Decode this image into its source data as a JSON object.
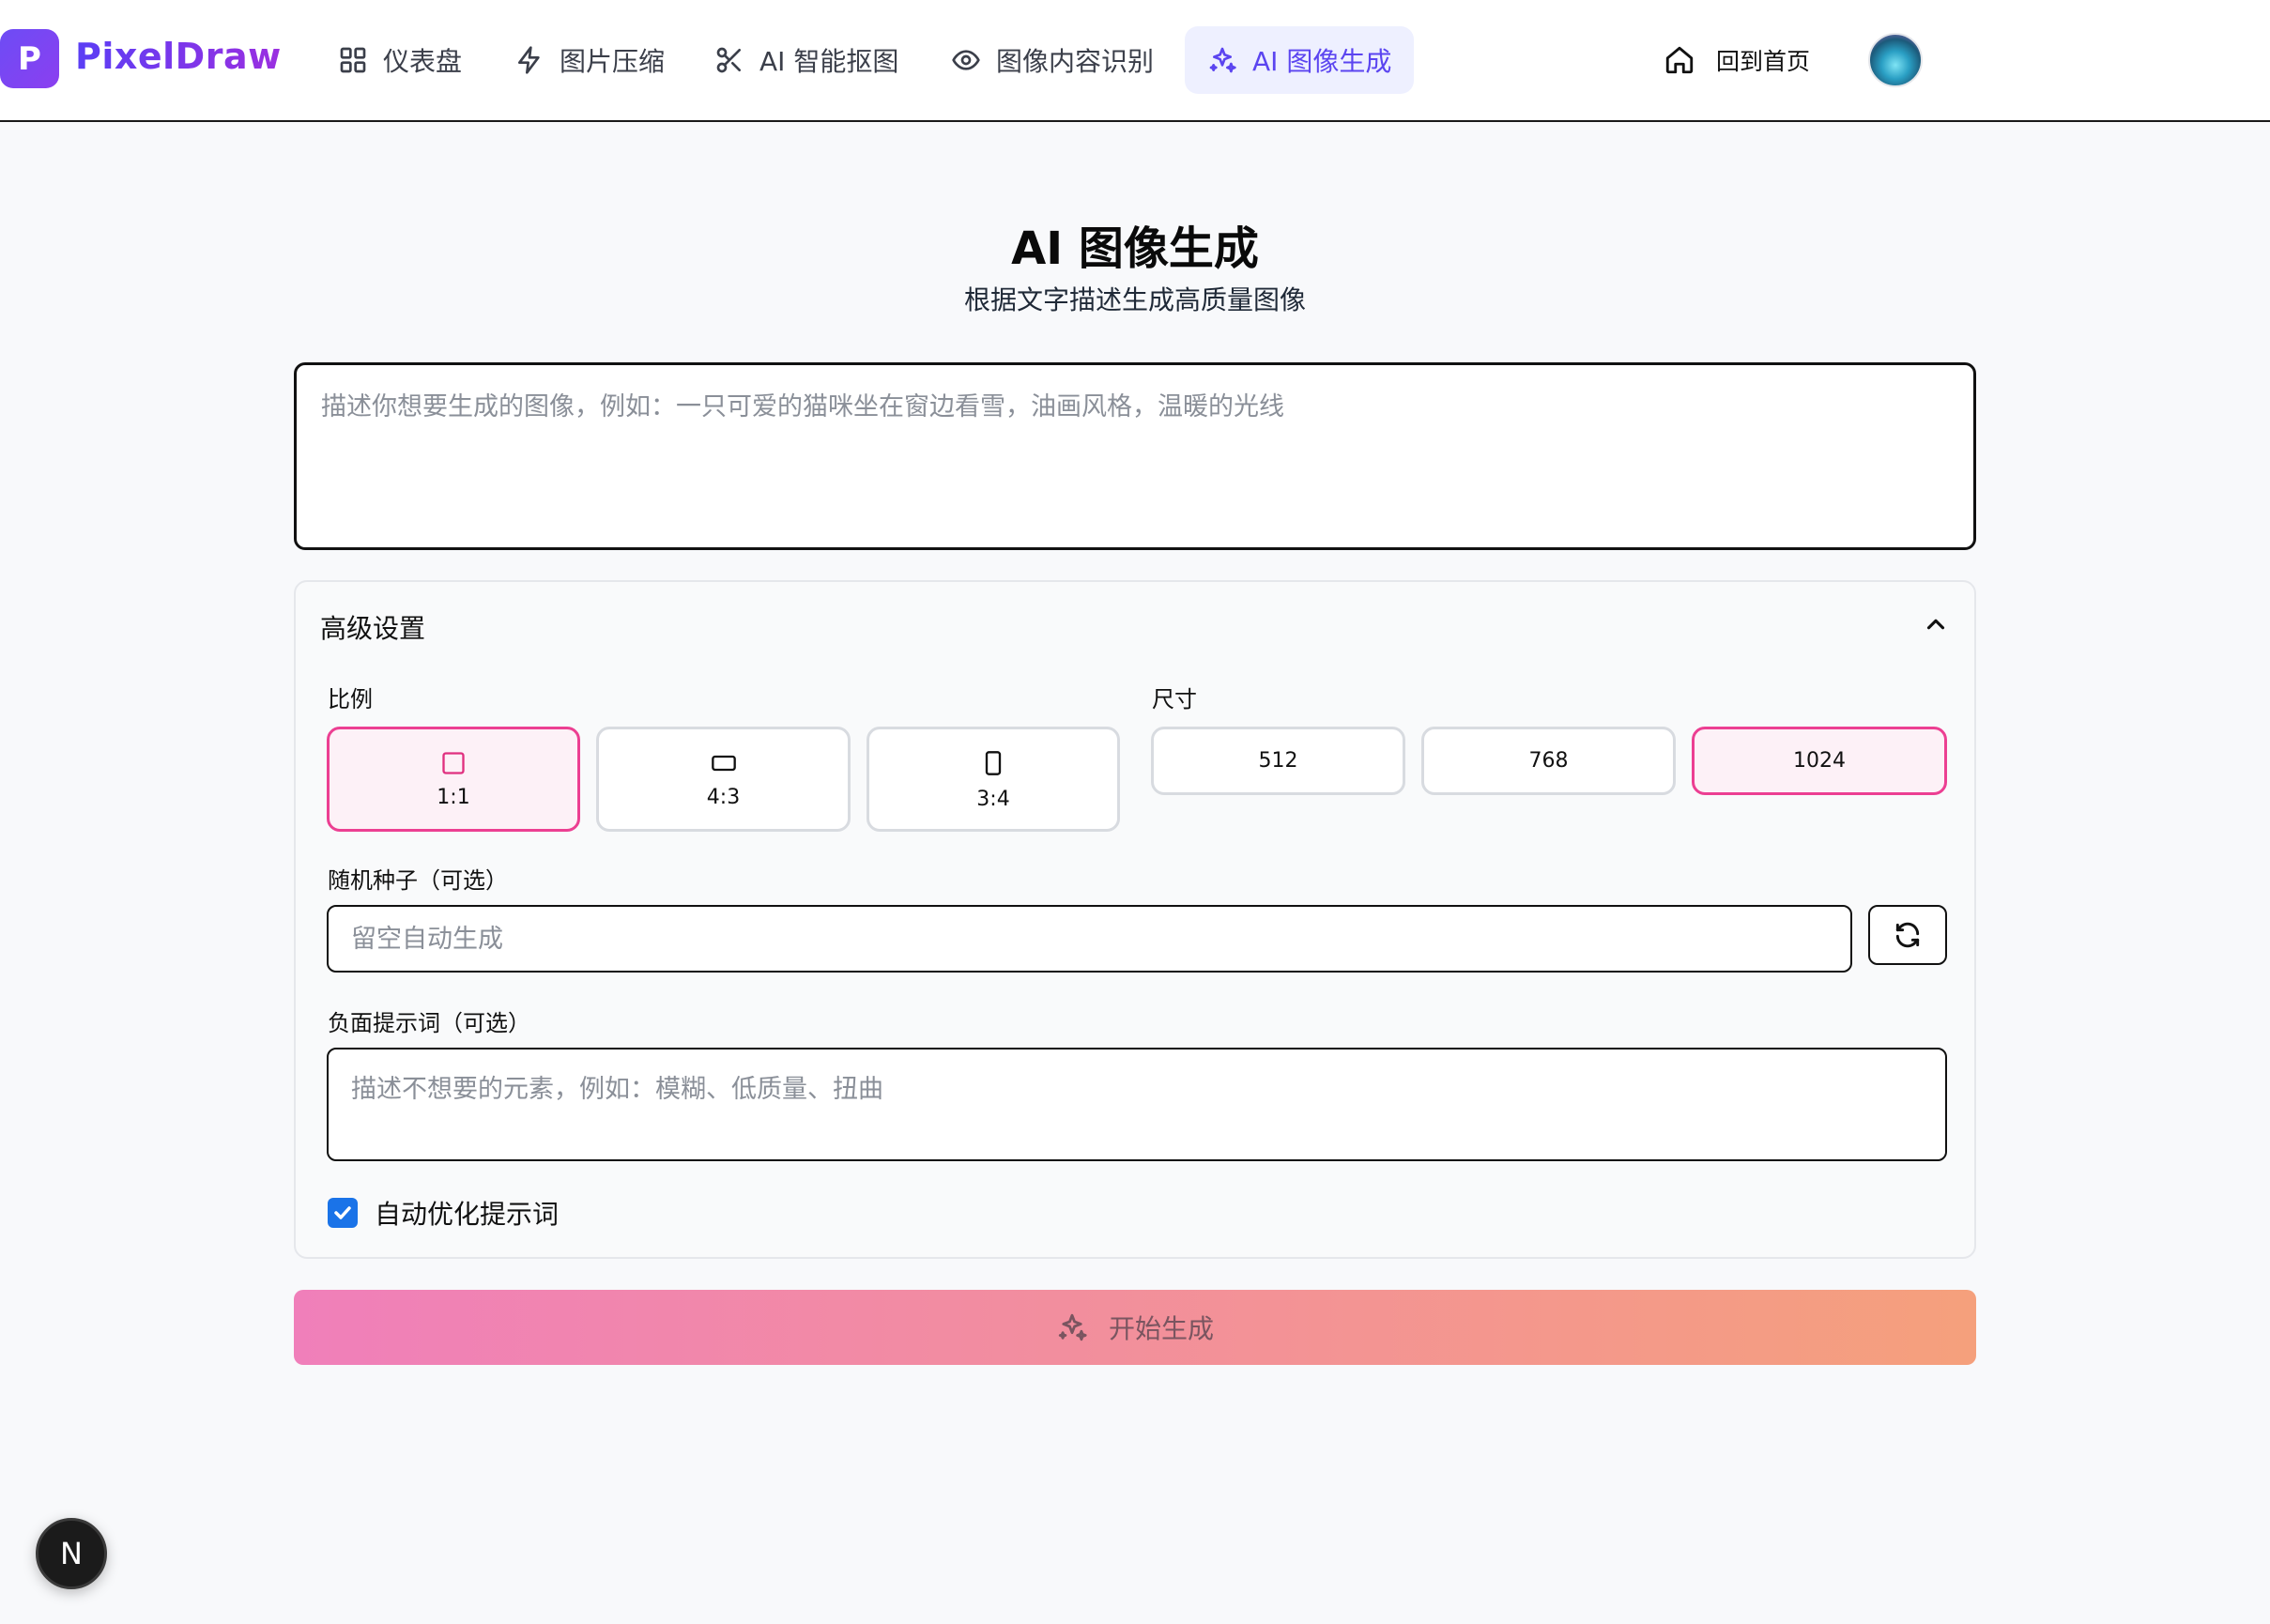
{
  "app": {
    "logo_letter": "P",
    "name": "PixelDraw"
  },
  "nav": {
    "items": [
      {
        "label": "仪表盘",
        "icon": "grid-icon"
      },
      {
        "label": "图片压缩",
        "icon": "lightning-icon"
      },
      {
        "label": "AI 智能抠图",
        "icon": "scissors-icon"
      },
      {
        "label": "图像内容识别",
        "icon": "eye-icon"
      },
      {
        "label": "AI 图像生成",
        "icon": "sparkles-icon",
        "active": true
      }
    ],
    "home_label": "回到首页"
  },
  "page": {
    "title": "AI 图像生成",
    "subtitle": "根据文字描述生成高质量图像",
    "prompt_placeholder": "描述你想要生成的图像，例如：一只可爱的猫咪坐在窗边看雪，油画风格，温暖的光线"
  },
  "advanced": {
    "title": "高级设置",
    "ratio_label": "比例",
    "ratios": [
      {
        "label": "1:1",
        "selected": true
      },
      {
        "label": "4:3",
        "selected": false
      },
      {
        "label": "3:4",
        "selected": false
      }
    ],
    "size_label": "尺寸",
    "sizes": [
      {
        "label": "512",
        "selected": false
      },
      {
        "label": "768",
        "selected": false
      },
      {
        "label": "1024",
        "selected": true
      }
    ],
    "seed_label": "随机种子（可选）",
    "seed_placeholder": "留空自动生成",
    "negative_label": "负面提示词（可选）",
    "negative_placeholder": "描述不想要的元素，例如：模糊、低质量、扭曲",
    "auto_optimize_label": "自动优化提示词",
    "auto_optimize_checked": true
  },
  "generate_button": "开始生成",
  "dev_badge": "N",
  "colors": {
    "accent": "#5b45f0",
    "selected_border": "#ec3f92",
    "button_gradient_start": "#f07fba",
    "button_gradient_end": "#f5a07c"
  }
}
